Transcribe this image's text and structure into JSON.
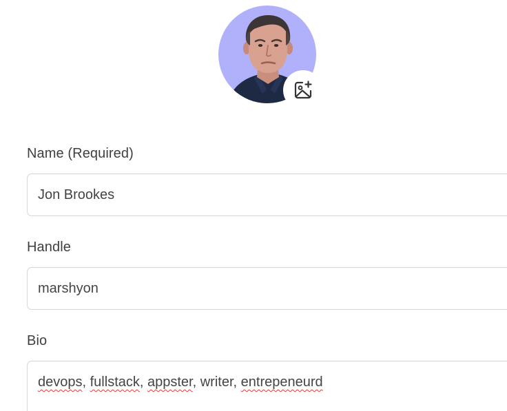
{
  "profile": {
    "avatar_alt": "Profile photo",
    "avatar_bg": "#b1b1fb",
    "edit_photo_icon": "image-plus-icon"
  },
  "fields": {
    "name": {
      "label": "Name (Required)",
      "value": "Jon Brookes"
    },
    "handle": {
      "label": "Handle",
      "value": "marshyon"
    },
    "bio": {
      "label": "Bio",
      "words": [
        "devops",
        "fullstack",
        "appster",
        "writer",
        "entrepeneurd"
      ],
      "separator": ", ",
      "misspelled": [
        "devops",
        "fullstack",
        "appster",
        "entrepeneurd"
      ]
    }
  }
}
